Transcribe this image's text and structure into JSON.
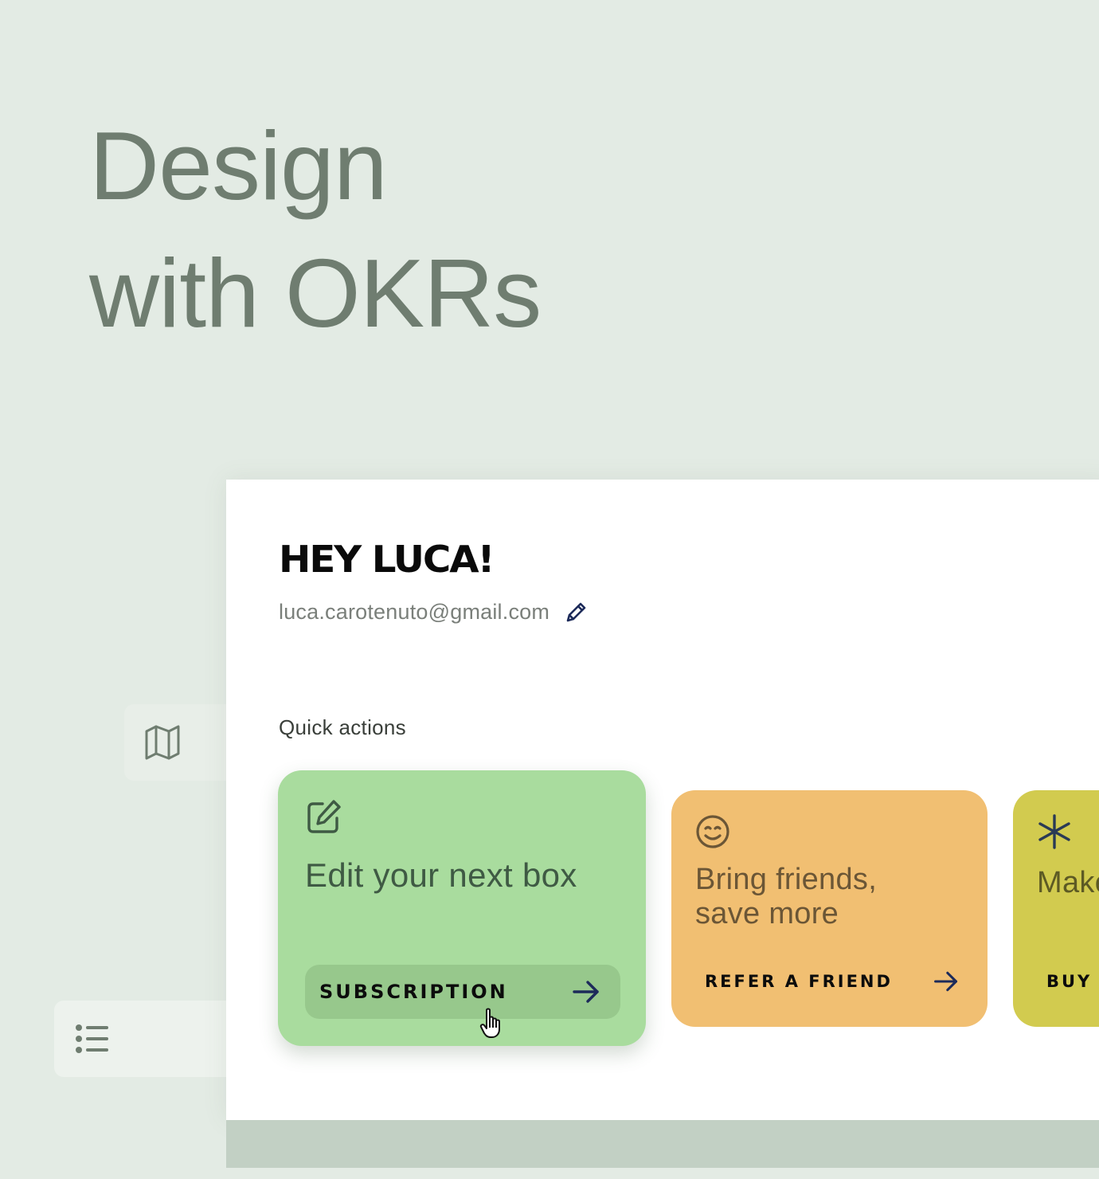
{
  "hero": {
    "line1": "Design",
    "line2": "with OKRs"
  },
  "side_nav": {
    "map_icon": "map-icon",
    "list_icon": "list-icon"
  },
  "profile": {
    "greeting": "HEY LUCA!",
    "email": "luca.carotenuto@gmail.com",
    "edit_icon": "pencil-icon"
  },
  "quick_actions": {
    "title": "Quick actions",
    "cards": [
      {
        "icon": "edit-square-icon",
        "title": "Edit your next box",
        "action_label": "SUBSCRIPTION",
        "color": "#a9dc9e"
      },
      {
        "icon": "smiley-icon",
        "title_line1": "Bring friends,",
        "title_line2": "save more",
        "action_label": "REFER A FRIEND",
        "color": "#f1bf72"
      },
      {
        "icon": "asterisk-icon",
        "title": "Make",
        "action_label": "BUY A",
        "color": "#d2cb4f"
      }
    ]
  },
  "colors": {
    "background": "#e3ebe4",
    "headline": "#6f7d70",
    "panel": "#ffffff",
    "arrow": "#1d2b5a"
  }
}
